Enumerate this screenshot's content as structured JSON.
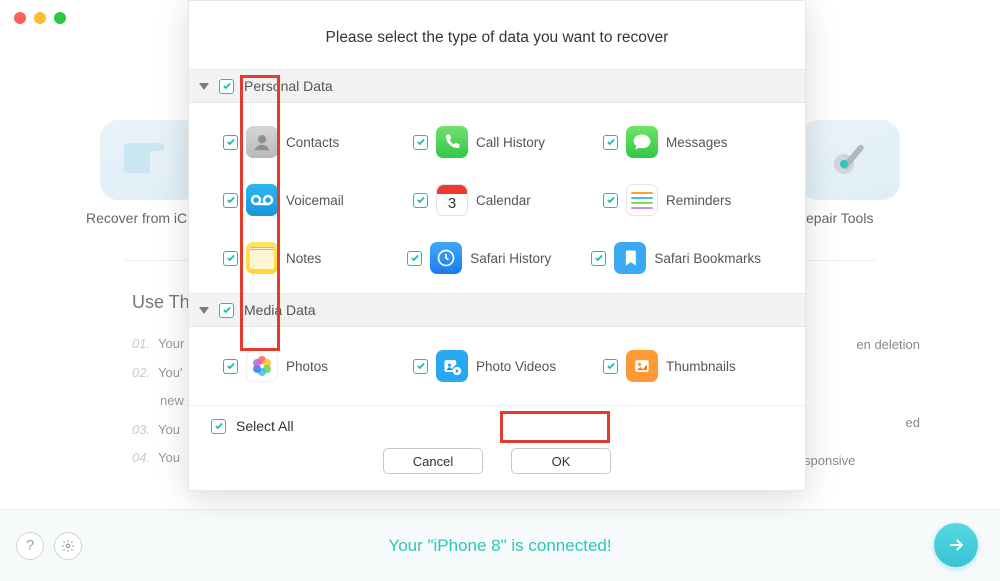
{
  "traffic_lights": [
    "close",
    "minimize",
    "zoom"
  ],
  "background": {
    "tab_left": "Recover from iC",
    "tab_right_fragment": "epair Tools",
    "use_this_heading": "Use Thi",
    "steps": [
      {
        "num": "01.",
        "text": "Your"
      },
      {
        "num": "02.",
        "text": "You'",
        "text2": "new"
      },
      {
        "num": "03.",
        "text": "You"
      },
      {
        "num": "04.",
        "text": "You"
      }
    ],
    "right_checks": [
      {
        "icon": "check",
        "text_fragments": [
          "en deletion"
        ]
      },
      {
        "icon": "check",
        "text_fragments": [
          "ed"
        ]
      },
      {
        "icon": "exclaim",
        "text_fragments": [
          "Device is broken & unresponsive"
        ]
      }
    ]
  },
  "footer": {
    "status_text": "Your \"iPhone 8\" is connected!",
    "help_icon": "help-icon",
    "settings_icon": "gear-icon",
    "next_icon": "arrow-right-icon"
  },
  "modal": {
    "title": "Please select the type of data you want to recover",
    "sections": [
      {
        "name": "personal",
        "label": "Personal Data",
        "checked": true,
        "items": [
          {
            "key": "contacts",
            "label": "Contacts",
            "icon": "contacts-icon",
            "checked": true
          },
          {
            "key": "call_history",
            "label": "Call History",
            "icon": "phone-icon",
            "checked": true
          },
          {
            "key": "messages",
            "label": "Messages",
            "icon": "messages-icon",
            "checked": true
          },
          {
            "key": "voicemail",
            "label": "Voicemail",
            "icon": "voicemail-icon",
            "checked": true
          },
          {
            "key": "calendar",
            "label": "Calendar",
            "icon": "calendar-icon",
            "day": "3",
            "checked": true
          },
          {
            "key": "reminders",
            "label": "Reminders",
            "icon": "reminders-icon",
            "checked": true
          },
          {
            "key": "notes",
            "label": "Notes",
            "icon": "notes-icon",
            "checked": true
          },
          {
            "key": "safari_history",
            "label": "Safari History",
            "icon": "safari-history-icon",
            "checked": true
          },
          {
            "key": "safari_bookmarks",
            "label": "Safari Bookmarks",
            "icon": "safari-bookmarks-icon",
            "checked": true
          }
        ]
      },
      {
        "name": "media",
        "label": "Media Data",
        "checked": true,
        "items": [
          {
            "key": "photos",
            "label": "Photos",
            "icon": "photos-icon",
            "checked": true
          },
          {
            "key": "photo_videos",
            "label": "Photo Videos",
            "icon": "photo-videos-icon",
            "checked": true
          },
          {
            "key": "thumbnails",
            "label": "Thumbnails",
            "icon": "thumbnails-icon",
            "checked": true
          }
        ]
      }
    ],
    "select_all": {
      "label": "Select All",
      "checked": true
    },
    "buttons": {
      "cancel": "Cancel",
      "ok": "OK"
    }
  },
  "colors": {
    "accent_teal": "#17c0b0",
    "highlight_red": "#e53b2f"
  }
}
